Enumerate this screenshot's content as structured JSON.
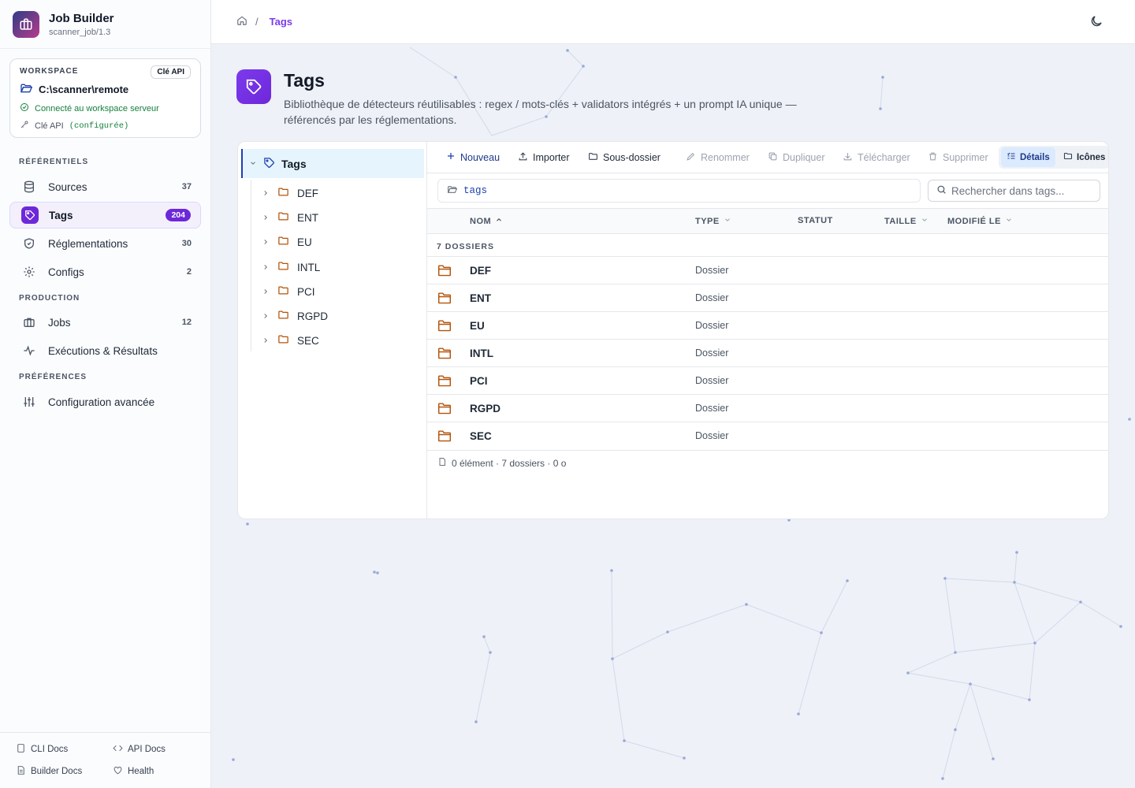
{
  "app": {
    "title": "Job Builder",
    "subtitle": "scanner_job/1.3"
  },
  "workspace": {
    "label": "WORKSPACE",
    "api_badge": "Clé API",
    "path": "C:\\scanner\\remote",
    "status": "Connecté au workspace serveur",
    "api_key_label": "Clé API",
    "api_key_state": "(configurée)"
  },
  "sections": {
    "referentiels": "RÉFÉRENTIELS",
    "production": "PRODUCTION",
    "preferences": "PRÉFÉRENCES"
  },
  "nav": {
    "sources": {
      "label": "Sources",
      "count": "37"
    },
    "tags": {
      "label": "Tags",
      "count": "204"
    },
    "reglementations": {
      "label": "Réglementations",
      "count": "30"
    },
    "configs": {
      "label": "Configs",
      "count": "2"
    },
    "jobs": {
      "label": "Jobs",
      "count": "12"
    },
    "executions": {
      "label": "Exécutions & Résultats"
    },
    "advanced": {
      "label": "Configuration avancée"
    }
  },
  "footer": {
    "cli": "CLI Docs",
    "api": "API Docs",
    "builder": "Builder Docs",
    "health": "Health"
  },
  "breadcrumb": {
    "separator": "/",
    "current": "Tags"
  },
  "page": {
    "title": "Tags",
    "description": "Bibliothèque de détecteurs réutilisables : regex / mots-clés + validators intégrés + un prompt IA unique — référencés par les réglementations."
  },
  "tree": {
    "root": "Tags",
    "children": [
      "DEF",
      "ENT",
      "EU",
      "INTL",
      "PCI",
      "RGPD",
      "SEC"
    ]
  },
  "toolbar": {
    "new": "Nouveau",
    "import": "Importer",
    "subfolder": "Sous-dossier",
    "rename": "Renommer",
    "duplicate": "Dupliquer",
    "download": "Télécharger",
    "delete": "Supprimer",
    "details": "Détails",
    "icons": "Icônes"
  },
  "path": "tags",
  "search": {
    "placeholder": "Rechercher dans tags..."
  },
  "table": {
    "headers": {
      "name": "NOM",
      "type": "TYPE",
      "status": "STATUT",
      "size": "TAILLE",
      "modified": "MODIFIÉ LE"
    },
    "group_label": "7 DOSSIERS",
    "rows": [
      {
        "name": "DEF",
        "type": "Dossier"
      },
      {
        "name": "ENT",
        "type": "Dossier"
      },
      {
        "name": "EU",
        "type": "Dossier"
      },
      {
        "name": "INTL",
        "type": "Dossier"
      },
      {
        "name": "PCI",
        "type": "Dossier"
      },
      {
        "name": "RGPD",
        "type": "Dossier"
      },
      {
        "name": "SEC",
        "type": "Dossier"
      }
    ],
    "summary": "0 élément · 7 dossiers · 0 o"
  },
  "colors": {
    "accent": "#7c3aed",
    "active_nav": "#6d28d9",
    "link": "#1e40af",
    "success": "#15803d",
    "folder": "#b45309"
  },
  "icons": [
    "briefcase-icon",
    "folder-open-icon",
    "check-circle-icon",
    "key-icon",
    "database-icon",
    "tag-icon",
    "shield-icon",
    "gear-icon",
    "activity-icon",
    "sliders-icon",
    "file-icon",
    "code-icon",
    "heart-icon",
    "home-icon",
    "moon-icon",
    "plus-icon",
    "upload-icon",
    "folder-icon",
    "pencil-icon",
    "copy-icon",
    "download-icon",
    "trash-icon",
    "list-icon",
    "search-icon",
    "chevron-right-icon",
    "chevron-down-icon"
  ]
}
